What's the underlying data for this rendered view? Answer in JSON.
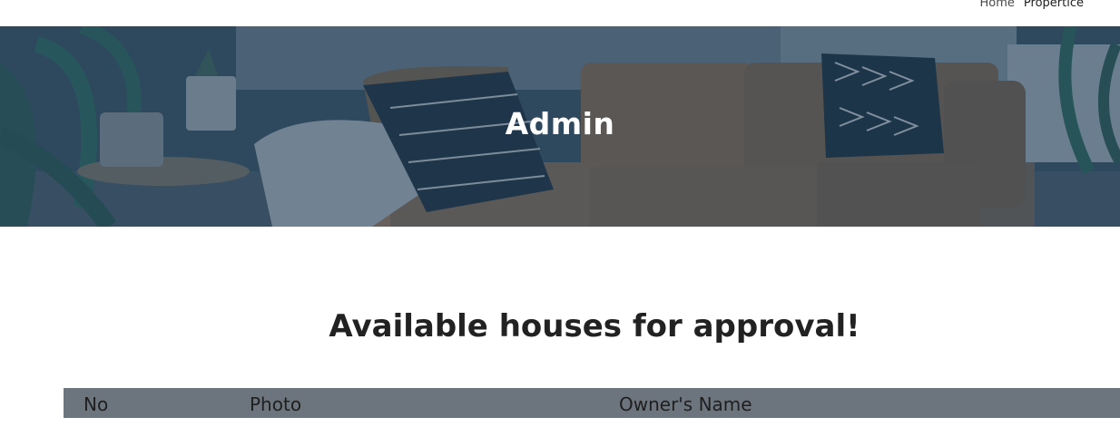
{
  "nav": {
    "items": [
      {
        "label": "Home"
      },
      {
        "label": "Propertice"
      }
    ]
  },
  "hero": {
    "title": "Admin"
  },
  "section": {
    "title": "Available houses for approval!"
  },
  "table": {
    "columns": [
      "No",
      "Photo",
      "Owner's Name"
    ]
  },
  "colors": {
    "hero_overlay": "#2f4656",
    "table_header": "#6c757d",
    "heading_text": "#222222"
  }
}
